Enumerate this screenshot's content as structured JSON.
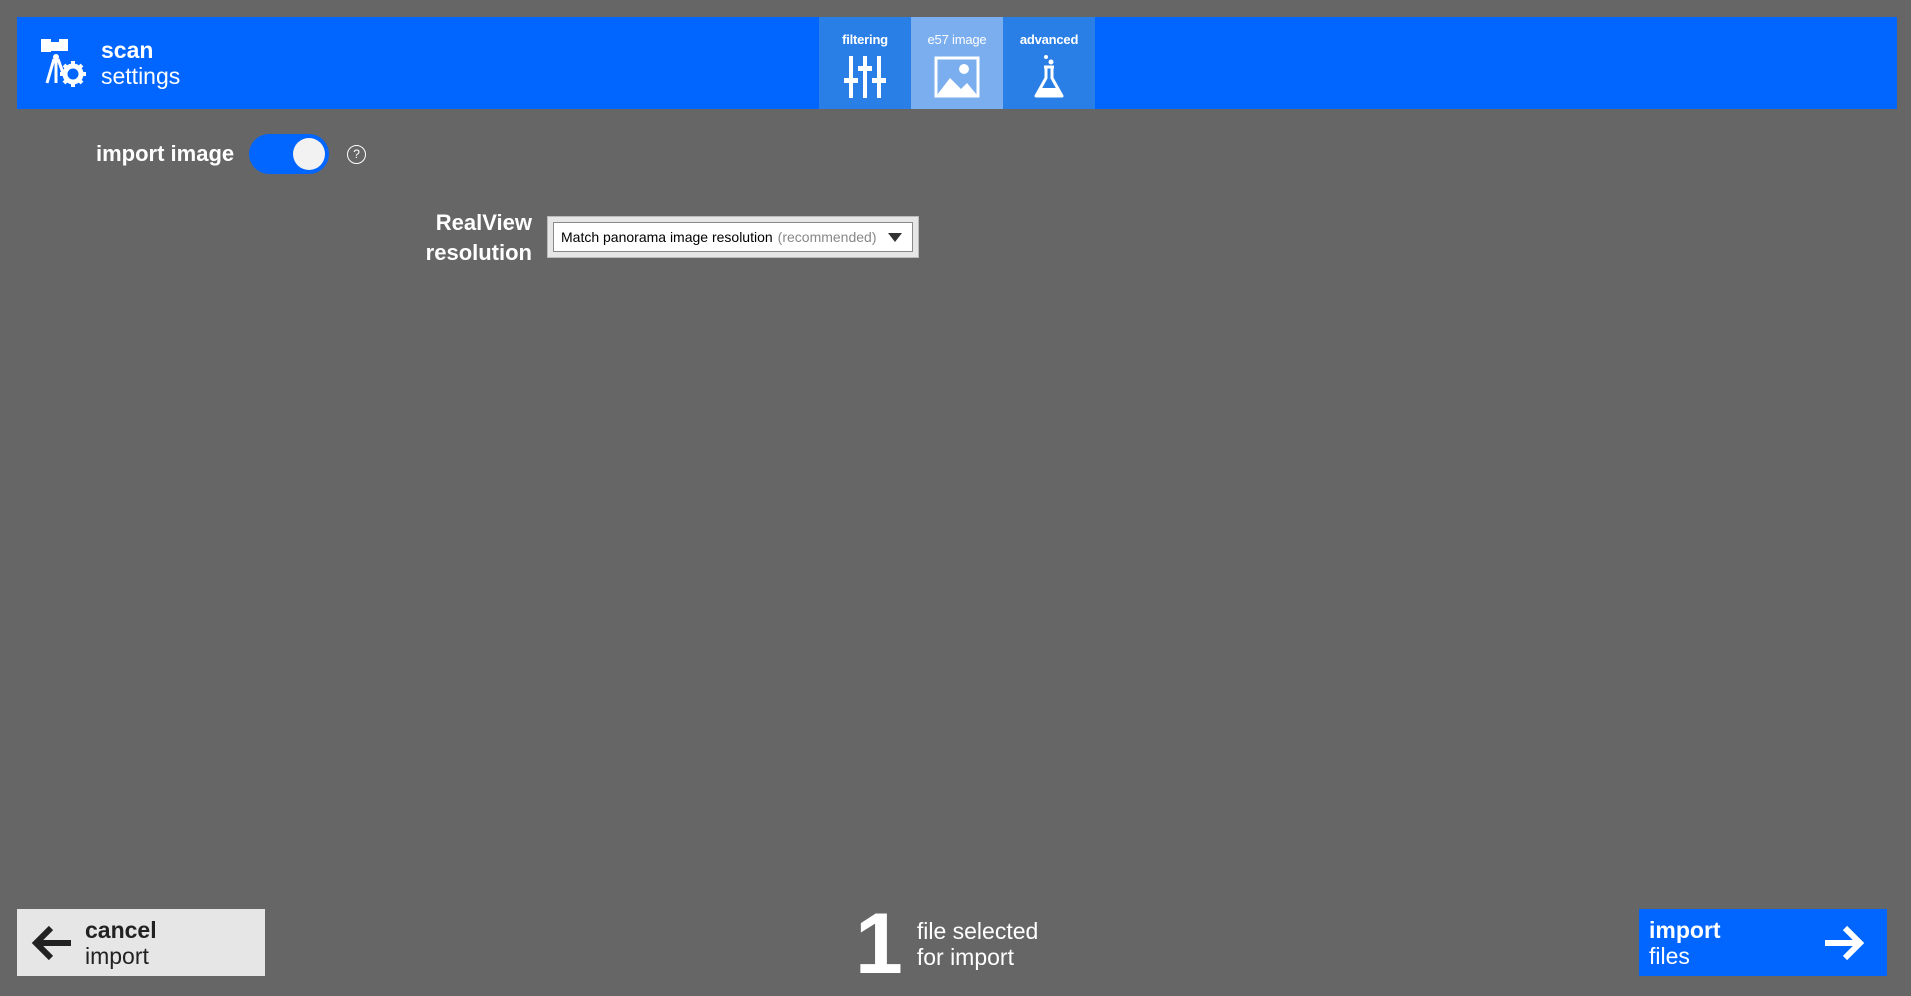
{
  "header": {
    "title": "scan",
    "subtitle": "settings",
    "icon": "scan-settings-icon"
  },
  "tabs": [
    {
      "label": "filtering",
      "icon": "sliders-icon",
      "active": false
    },
    {
      "label": "e57 image",
      "icon": "image-icon",
      "active": true
    },
    {
      "label": "advanced",
      "icon": "flask-icon",
      "active": false
    }
  ],
  "import_image": {
    "label": "import image",
    "enabled": true,
    "help": "?"
  },
  "resolution": {
    "label_line1": "RealView",
    "label_line2": "resolution",
    "selected": "Match panorama image resolution",
    "hint": "(recommended)"
  },
  "footer": {
    "cancel_title": "cancel",
    "cancel_sub": "import",
    "file_count": "1",
    "status_line1": "file selected",
    "status_line2": "for import",
    "import_title": "import",
    "import_sub": "files"
  },
  "colors": {
    "background": "#666666",
    "accent": "#0066ff",
    "tab": "#2a7fe6",
    "tab_active": "#7aaeee"
  }
}
